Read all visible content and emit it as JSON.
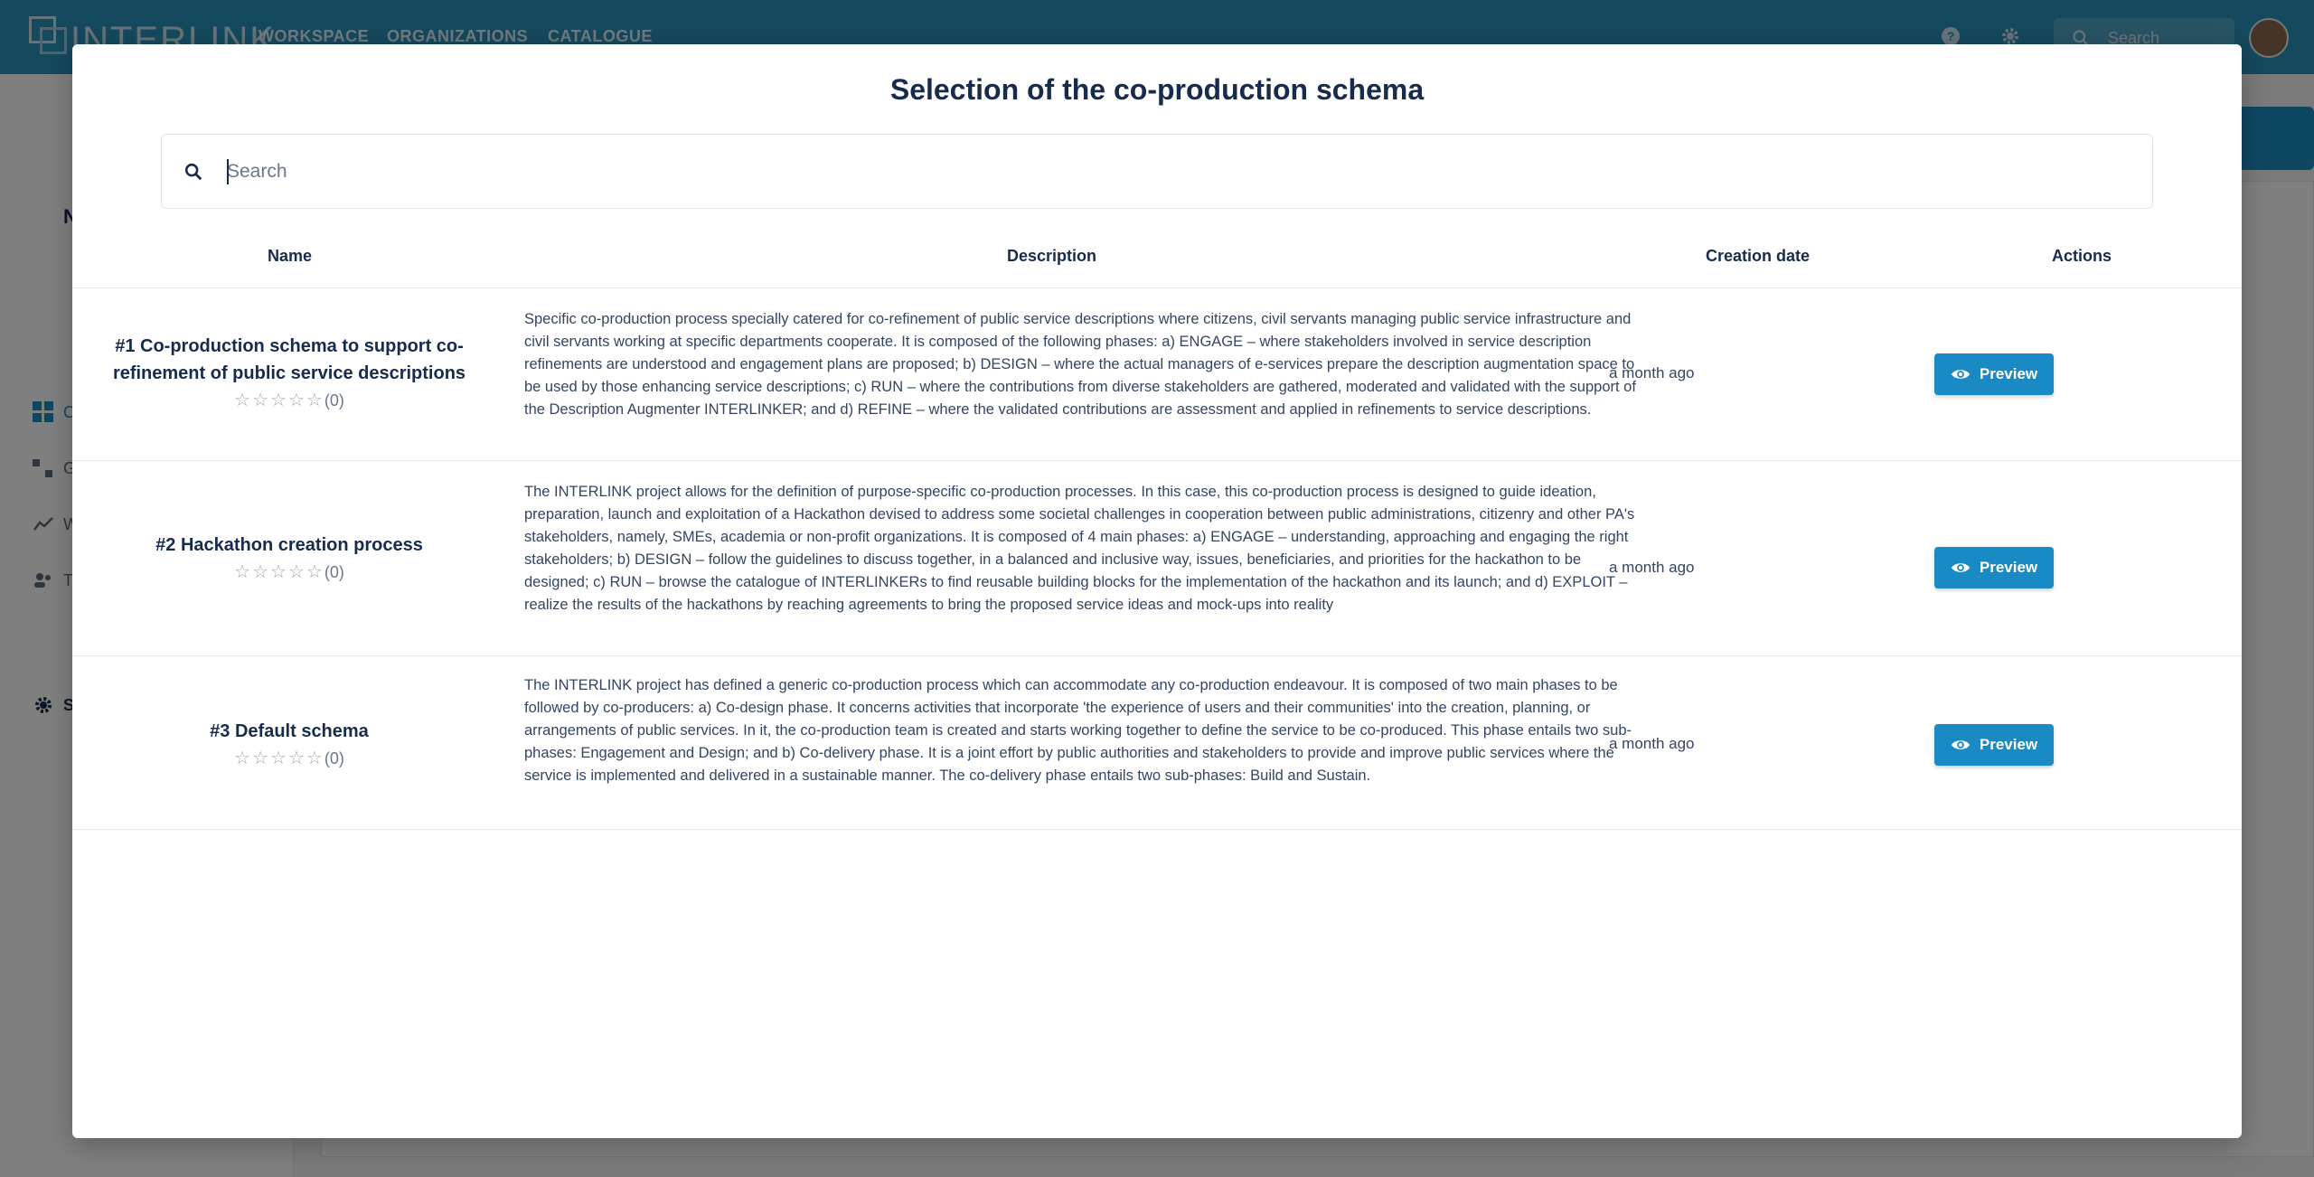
{
  "background": {
    "logo_text": "INTERLINK",
    "nav": [
      "WORKSPACE",
      "ORGANIZATIONS",
      "CATALOGUE"
    ],
    "search_placeholder": "Search",
    "sidebar_letters": [
      "C",
      "G",
      "W",
      "T",
      "S"
    ],
    "heading_letter": "N"
  },
  "modal": {
    "title": "Selection of the co-production schema",
    "search_placeholder": "Search",
    "columns": {
      "name": "Name",
      "description": "Description",
      "creation_date": "Creation date",
      "actions": "Actions"
    },
    "rows": [
      {
        "name": "#1 Co-production schema to support co-refinement of public service descriptions",
        "rating_count": "(0)",
        "description": "Specific co-production process specially catered for co-refinement of public service descriptions where citizens, civil servants managing public service infrastructure and civil servants working at specific departments cooperate. It is composed of the following phases: a) ENGAGE – where stakeholders involved in service description refinements are understood and engagement plans are proposed; b) DESIGN – where the actual managers of e-services prepare the description augmentation space to be used by those enhancing service descriptions; c) RUN – where the contributions from diverse stakeholders are gathered, moderated and validated with the support of the Description Augmenter INTERLINKER; and d) REFINE – where the validated contributions are assessment and applied in refinements to service descriptions.",
        "creation_date": "a month ago",
        "action_label": "Preview"
      },
      {
        "name": "#2 Hackathon creation process",
        "rating_count": "(0)",
        "description": "The INTERLINK project allows for the definition of purpose-specific co-production processes. In this case, this co-production process is designed to guide ideation, preparation, launch and exploitation of a Hackathon devised to address some societal challenges in cooperation between public administrations, citizenry and other PA's stakeholders, namely, SMEs, academia or non-profit organizations. It is composed of 4 main phases: a) ENGAGE – understanding, approaching and engaging the right stakeholders; b) DESIGN – follow the guidelines to discuss together, in a balanced and inclusive way, issues, beneficiaries, and priorities for the hackathon to be designed; c) RUN – browse the catalogue of INTERLINKERs to find reusable building blocks for the implementation of the hackathon and its launch; and d) EXPLOIT – realize the results of the hackathons by reaching agreements to bring the proposed service ideas and mock-ups into reality",
        "creation_date": "a month ago",
        "action_label": "Preview"
      },
      {
        "name": "#3 Default schema",
        "rating_count": "(0)",
        "description": "The INTERLINK project has defined a generic co-production process which can accommodate any co-production endeavour. It is composed of two main phases to be followed by co-producers: a) Co-design phase. It concerns activities that incorporate 'the experience of users and their communities' into the creation, planning, or arrangements of public services. In it, the co-production team is created and starts working together to define the service to be co-produced. This phase entails two sub-phases: Engagement and Design; and b) Co-delivery phase. It is a joint effort by public authorities and stakeholders to provide and improve public services where the service is implemented and delivered in a sustainable manner. The co-delivery phase entails two sub-phases: Build and Sustain.",
        "creation_date": "a month ago",
        "action_label": "Preview"
      }
    ]
  },
  "colors": {
    "topbar": "#2a93bd",
    "accent": "#1a8ac5",
    "text": "#172b4d"
  }
}
